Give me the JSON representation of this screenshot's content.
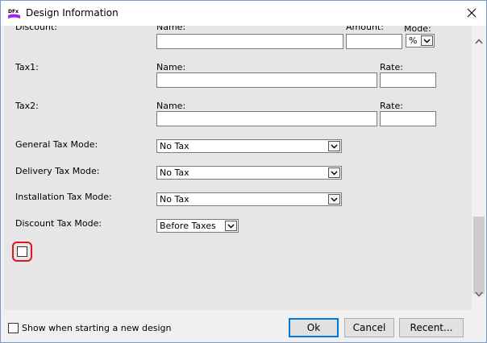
{
  "window": {
    "title": "Design Information",
    "app_icon_text": "DFx"
  },
  "discount": {
    "label": "Discount:",
    "name_label": "Name:",
    "amount_label": "Amount:",
    "mode_label": "Mode:",
    "mode_value": "%"
  },
  "tax1": {
    "label": "Tax1:",
    "name_label": "Name:",
    "rate_label": "Rate:"
  },
  "tax2": {
    "label": "Tax2:",
    "name_label": "Name:",
    "rate_label": "Rate:"
  },
  "general_tax_mode": {
    "label": "General Tax Mode:",
    "value": "No Tax"
  },
  "delivery_tax_mode": {
    "label": "Delivery Tax Mode:",
    "value": "No Tax"
  },
  "installation_tax_mode": {
    "label": "Installation Tax Mode:",
    "value": "No Tax"
  },
  "discount_tax_mode": {
    "label": "Discount Tax Mode:",
    "value": "Before Taxes"
  },
  "footer": {
    "show_on_start_label": "Show when starting a new design",
    "ok_label": "Ok",
    "cancel_label": "Cancel",
    "recent_label": "Recent..."
  },
  "colors": {
    "highlight_ring": "#e81123",
    "focus_border": "#0078d7"
  }
}
